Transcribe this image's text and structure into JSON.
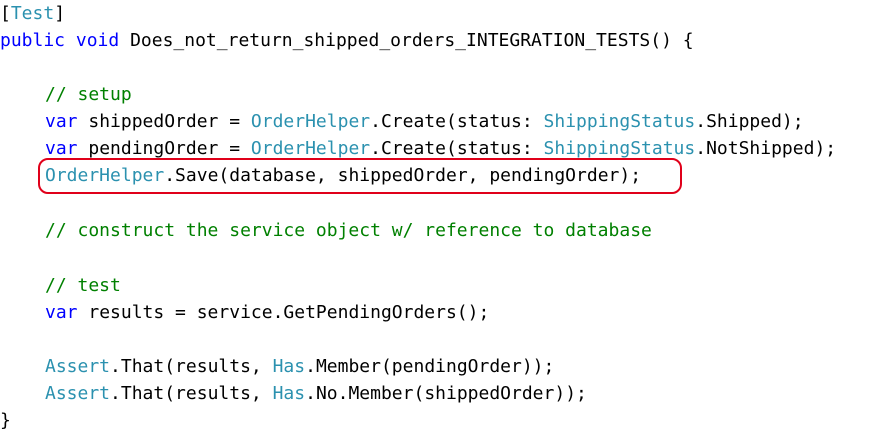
{
  "code": {
    "l0": {
      "attr_open": "[",
      "attr_name": "Test",
      "attr_close": "]"
    },
    "l1": {
      "kw_public": "public",
      "kw_void": "void",
      "method": " Does_not_return_shipped_orders_INTEGRATION_TESTS() {"
    },
    "l3": {
      "comment": "// setup"
    },
    "l4": {
      "kw_var": "var",
      "t1": " shippedOrder = ",
      "ty1": "OrderHelper",
      "t2": ".Create(status: ",
      "ty2": "ShippingStatus",
      "t3": ".Shipped);"
    },
    "l5": {
      "kw_var": "var",
      "t1": " pendingOrder = ",
      "ty1": "OrderHelper",
      "t2": ".Create(status: ",
      "ty2": "ShippingStatus",
      "t3": ".NotShipped);"
    },
    "l6": {
      "ty1": "OrderHelper",
      "t1": ".Save(database, shippedOrder, pendingOrder);"
    },
    "l8": {
      "comment": "// construct the service object w/ reference to database"
    },
    "l10": {
      "comment": "// test"
    },
    "l11": {
      "kw_var": "var",
      "t1": " results = service.GetPendingOrders();"
    },
    "l13": {
      "ty1": "Assert",
      "t1": ".That(results, ",
      "ty2": "Has",
      "t2": ".Member(pendingOrder));"
    },
    "l14": {
      "ty1": "Assert",
      "t1": ".That(results, ",
      "ty2": "Has",
      "t2": ".No.Member(shippedOrder));"
    },
    "l15": {
      "brace": "}"
    }
  },
  "colors": {
    "keyword": "#0000ff",
    "type": "#2b91af",
    "comment": "#008000",
    "highlight_border": "#e0001a"
  }
}
